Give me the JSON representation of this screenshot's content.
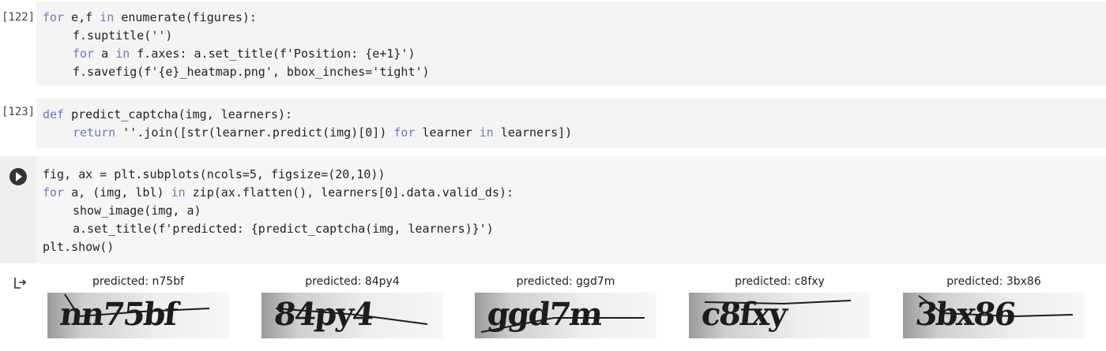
{
  "cells": [
    {
      "exec_count": "[122]",
      "lines": [
        {
          "parts": [
            {
              "t": "for",
              "k": "kw"
            },
            {
              "t": " e,f "
            },
            {
              "t": "in",
              "k": "kw"
            },
            {
              "t": " enumerate(figures):"
            }
          ],
          "indent": false
        },
        {
          "parts": [
            {
              "t": "f.suptitle('')"
            }
          ],
          "indent": true
        },
        {
          "parts": [
            {
              "t": "for",
              "k": "kw"
            },
            {
              "t": " a "
            },
            {
              "t": "in",
              "k": "kw"
            },
            {
              "t": " f.axes: a.set_title(f'Position: {e+1}')"
            }
          ],
          "indent": true
        },
        {
          "parts": [
            {
              "t": "f.savefig(f'{e}_heatmap.png', bbox_inches='tight')"
            }
          ],
          "indent": true
        }
      ]
    },
    {
      "exec_count": "[123]",
      "lines": [
        {
          "parts": [
            {
              "t": "def",
              "k": "kw"
            },
            {
              "t": " predict_captcha(img, learners):"
            }
          ],
          "indent": false
        },
        {
          "parts": [
            {
              "t": "return",
              "k": "kw"
            },
            {
              "t": " ''.join([str(learner.predict(img)[0]) "
            },
            {
              "t": "for",
              "k": "kw"
            },
            {
              "t": " learner "
            },
            {
              "t": "in",
              "k": "kw"
            },
            {
              "t": " learners])"
            }
          ],
          "indent": true
        }
      ]
    },
    {
      "exec_count": "",
      "lines": [
        {
          "parts": [
            {
              "t": "fig, ax = plt.subplots(ncols=5, figsize=(20,10))"
            }
          ],
          "indent": false
        },
        {
          "parts": [
            {
              "t": "for",
              "k": "kw"
            },
            {
              "t": " a, (img, lbl) "
            },
            {
              "t": "in",
              "k": "kw"
            },
            {
              "t": " zip(ax.flatten(), learners[0].data.valid_ds):"
            }
          ],
          "indent": false
        },
        {
          "parts": [
            {
              "t": "show_image(img, a)"
            }
          ],
          "indent": true
        },
        {
          "parts": [
            {
              "t": "a.set_title(f'predicted: {predict_captcha(img, learners)}')"
            }
          ],
          "indent": true
        },
        {
          "parts": [
            {
              "t": "plt.show()"
            }
          ],
          "indent": false
        }
      ]
    }
  ],
  "output": {
    "icon": "output-arrow-icon",
    "plots": [
      {
        "title": "predicted: n75bf",
        "captcha": "nn75bf"
      },
      {
        "title": "predicted: 84py4",
        "captcha": "84py4"
      },
      {
        "title": "predicted: ggd7m",
        "captcha": "ggd7m"
      },
      {
        "title": "predicted: c8fxy",
        "captcha": "c8fxy"
      },
      {
        "title": "predicted: 3bx86",
        "captcha": "3bx86"
      }
    ]
  },
  "colors": {
    "keyword": "#6d7ab8",
    "cell_bg": "#f4f4f4",
    "run_button": "#333333"
  }
}
